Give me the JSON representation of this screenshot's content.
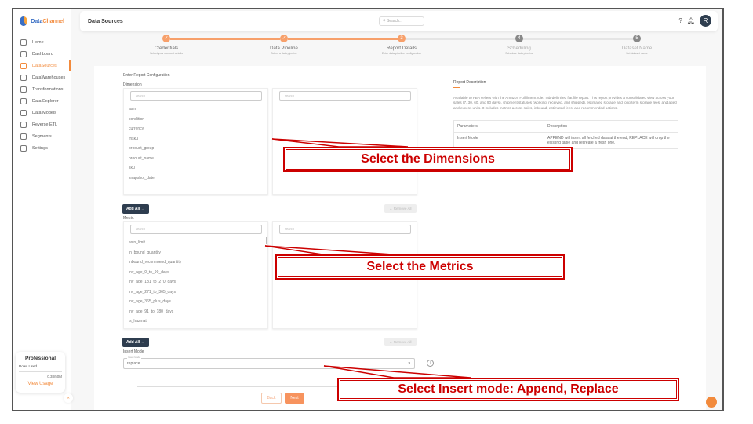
{
  "brand": {
    "name_a": "Data",
    "name_b": "Channel"
  },
  "sidebar": {
    "items": [
      {
        "label": "Home",
        "icon": "home-icon"
      },
      {
        "label": "Dashboard",
        "icon": "dashboard-icon"
      },
      {
        "label": "DataSources",
        "icon": "datasources-icon",
        "active": true
      },
      {
        "label": "DataWarehouses",
        "icon": "database-icon"
      },
      {
        "label": "Transformations",
        "icon": "transform-icon"
      },
      {
        "label": "Data Explorer",
        "icon": "explorer-icon"
      },
      {
        "label": "Data Models",
        "icon": "models-icon"
      },
      {
        "label": "Reverse ETL",
        "icon": "reverse-etl-icon"
      },
      {
        "label": "Segments",
        "icon": "segments-icon"
      },
      {
        "label": "Settings",
        "icon": "gear-icon"
      }
    ],
    "plan": {
      "name": "Professional",
      "rows_label": "Rows Used",
      "usage": "0.38/50M",
      "usage_fraction": 0.0076,
      "link": "View Usage"
    }
  },
  "header": {
    "title": "Data Sources",
    "search_placeholder": "Search...",
    "avatar": "R"
  },
  "stepper": [
    {
      "label": "Credentials",
      "sub": "Select your account details",
      "state": "done"
    },
    {
      "label": "Data Pipeline",
      "sub": "Select a data pipeline",
      "state": "done"
    },
    {
      "label": "Report Details",
      "sub": "Enter data pipeline configuration",
      "state": "current",
      "num": "3"
    },
    {
      "label": "Scheduling",
      "sub": "Schedule data pipeline",
      "state": "todo",
      "num": "4"
    },
    {
      "label": "Dataset Name",
      "sub": "Set dataset name",
      "state": "todo",
      "num": "5"
    }
  ],
  "config": {
    "title": "Enter Report Configuration",
    "dimension_label": "Dimension",
    "metric_label": "Metric",
    "search_placeholder": "search",
    "dimensions": [
      "asin",
      "condition",
      "currency",
      "fnsku",
      "product_group",
      "product_name",
      "sku",
      "snapshot_date"
    ],
    "metrics": [
      "asin_limit",
      "in_bound_quantity",
      "inbound_recommend_quantity",
      "inv_age_0_to_90_days",
      "inv_age_181_to_270_days",
      "inv_age_271_to_365_days",
      "inv_age_365_plus_days",
      "inv_age_91_to_180_days",
      "is_hazmat"
    ],
    "add_all": "Add All →",
    "remove_all": "← Remove All",
    "insert_mode_label": "Insert Mode",
    "insert_mode_caption": "Insert Mode",
    "insert_mode_value": "replace"
  },
  "report": {
    "title": "Report Description -",
    "description": "Available to FBA sellers with the Amazon Fulfillment role. Tab-delimited flat file report. This report provides a consolidated view across your sales (7, 30, 60, and 90 days), shipment statuses (working, received, and shipped), estimated storage and long-term storage fees, and aged and excess units. It includes metrics across sales, inbound, estimated fees, and recommended actions.",
    "table": {
      "headers": [
        "Parameters",
        "Description"
      ],
      "rows": [
        [
          "Insert Mode",
          "APPEND will insert all fetched data at the end, REPLACE will drop the existing table and recreate a fresh one."
        ]
      ]
    }
  },
  "buttons": {
    "back": "Back",
    "next": "Next"
  },
  "callouts": {
    "dimensions": "Select the Dimensions",
    "metrics": "Select the Metrics",
    "insert": "Select Insert mode: Append, Replace"
  },
  "colors": {
    "accent": "#f28a3c",
    "dark": "#2e3d4f",
    "callout": "#cc0000"
  }
}
